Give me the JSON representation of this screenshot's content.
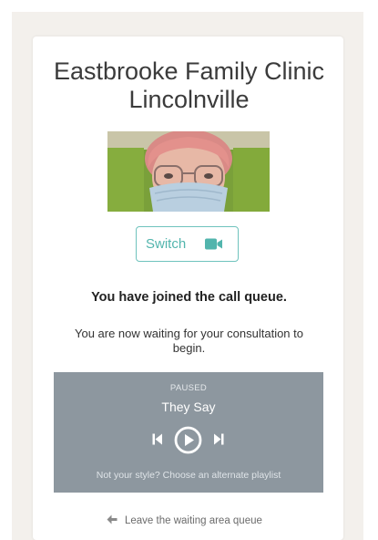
{
  "clinic": {
    "name_line1": "Eastbrooke Family Clinic",
    "name_line2": "Lincolnville"
  },
  "camera": {
    "switch_label": "Switch",
    "icon": "video-camera-icon"
  },
  "queue": {
    "heading": "You have joined the call queue.",
    "message": "You are now waiting for your consultation to begin."
  },
  "player": {
    "status": "PAUSED",
    "track": "They Say",
    "alt_playlist": "Not your style? Choose an alternate playlist",
    "icons": [
      "previous-track-icon",
      "play-icon",
      "next-track-icon"
    ]
  },
  "footer": {
    "leave_label": "Leave the waiting area queue",
    "icon": "arrow-left-icon"
  },
  "colors": {
    "accent": "#52b5ad",
    "player_bg": "#8d979f",
    "backdrop": "#f3f0ec"
  }
}
